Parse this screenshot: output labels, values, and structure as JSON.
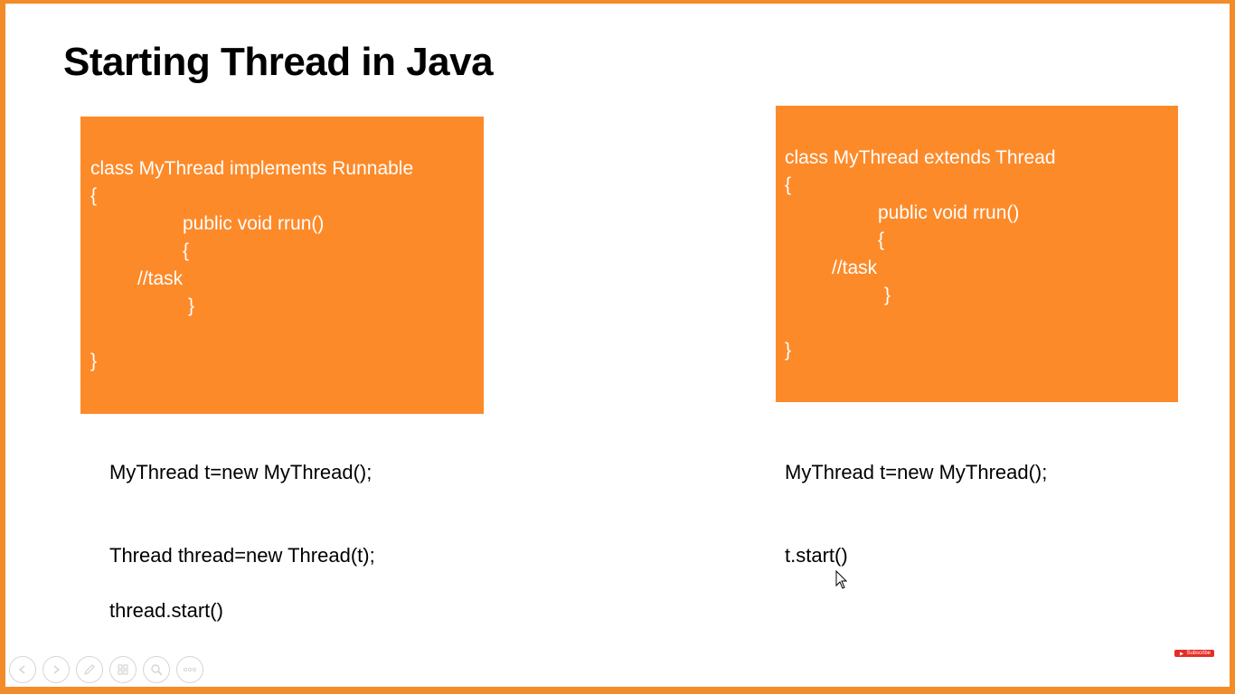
{
  "title": "Starting Thread in Java",
  "left_box": {
    "lines": [
      "class MyThread implements Runnable",
      "{",
      "public void rrun()",
      "{",
      "//task",
      "}",
      "}"
    ]
  },
  "right_box": {
    "lines": [
      "class MyThread extends Thread",
      "{",
      "public void rrun()",
      "{",
      "//task",
      "}",
      "}"
    ]
  },
  "left_code": {
    "line1": "MyThread t=new MyThread();",
    "line2": "Thread thread=new Thread(t);",
    "line3": "thread.start()"
  },
  "right_code": {
    "line1": "MyThread t=new MyThread();",
    "line2": "t.start()"
  },
  "badge": {
    "label": "Subscribe"
  },
  "toolbar": {
    "buttons": [
      "prev-icon",
      "next-icon",
      "pen-icon",
      "slides-icon",
      "zoom-icon",
      "more-icon"
    ]
  },
  "colors": {
    "accent": "#fd8a29",
    "frame": "#f28c28"
  }
}
